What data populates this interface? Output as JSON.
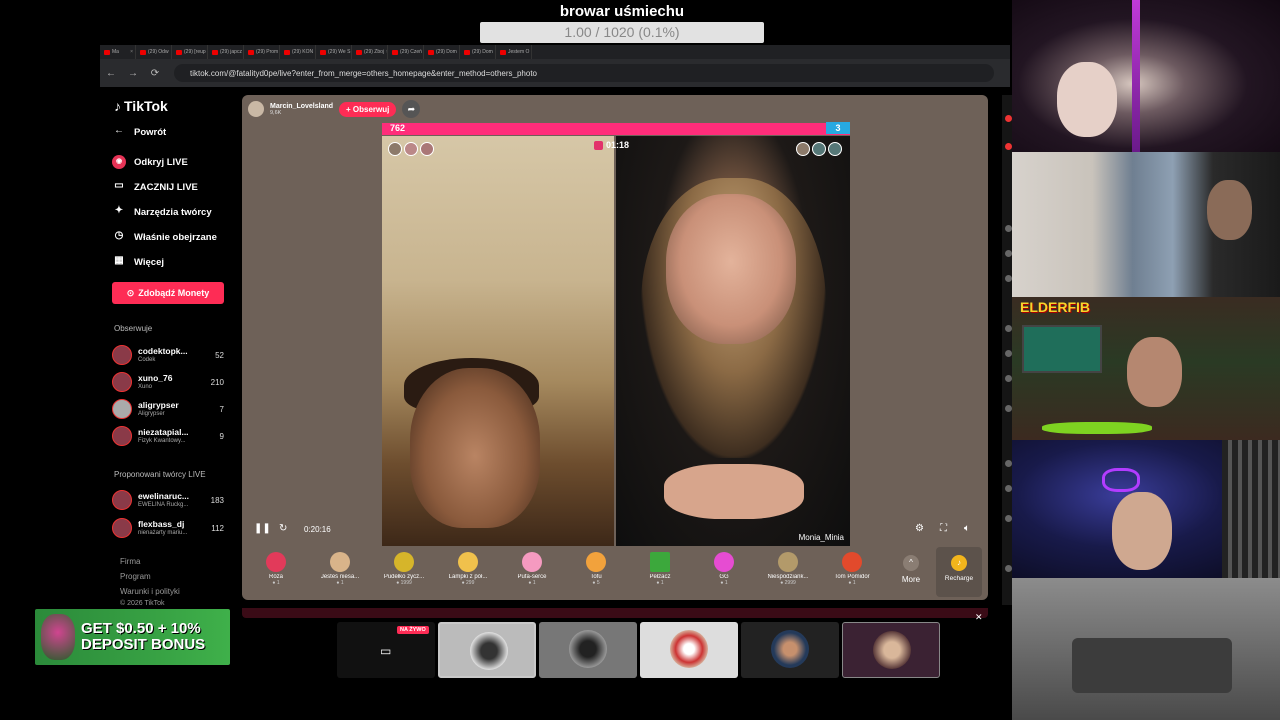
{
  "overlay": {
    "title": "browar uśmiechu",
    "goal_text": "1.00 / 1020 (0.1%)"
  },
  "browser": {
    "tabs": [
      "Ma",
      "(29) Odw",
      "(29) [reup",
      "(29) japcz",
      "(29) Prom",
      "(29) KON",
      "(29) We S",
      "(29) Zboj",
      "(29) Czeń",
      "(29) Dom",
      "(29) Dom",
      "Jestem O"
    ],
    "url": "tiktok.com/@fatalityd0pe/live?enter_from_merge=others_homepage&enter_method=others_photo"
  },
  "sidebar": {
    "logo": "TikTok",
    "nav": [
      {
        "label": "Powrót",
        "icon": "back-arrow-icon"
      },
      {
        "label": "Odkryj LIVE",
        "icon": "live-icon"
      },
      {
        "label": "ZACZNIJ LIVE",
        "icon": "camera-icon"
      },
      {
        "label": "Narzędzia twórcy",
        "icon": "lightbulb-icon"
      },
      {
        "label": "Właśnie obejrzane",
        "icon": "history-icon"
      },
      {
        "label": "Więcej",
        "icon": "more-icon"
      }
    ],
    "coins_button": "Zdobądź Monety",
    "followed_heading": "Obserwuje",
    "followed": [
      {
        "name": "codektopk...",
        "sub": "Codek",
        "count": "52"
      },
      {
        "name": "xuno_76",
        "sub": "Xuno",
        "count": "210"
      },
      {
        "name": "aligrypser",
        "sub": "Aligrypser",
        "count": "7"
      },
      {
        "name": "niezatapial...",
        "sub": "Fizyk Kwantowy...",
        "count": "9"
      }
    ],
    "suggested_heading": "Proponowani twórcy LIVE",
    "suggested": [
      {
        "name": "ewelinaruc...",
        "sub": "EWELINA Ruckg...",
        "count": "183"
      },
      {
        "name": "flexbass_dj",
        "sub": "nienażarty mariu...",
        "count": "112"
      }
    ],
    "footer": [
      "Firma",
      "Program",
      "Warunki i polityki",
      "© 2026 TikTok"
    ]
  },
  "player": {
    "host_name": "Marcin_Lovelsland",
    "host_views": "9,6K",
    "follow_label": "+ Obserwuj",
    "score_left": "762",
    "score_right": "3",
    "battle_timer": "01:18",
    "opponent_name": "Monia_Minia",
    "elapsed": "0:20:16",
    "gifts": [
      {
        "name": "Róża",
        "price": "1",
        "color": "#e23a5a"
      },
      {
        "name": "Jesteś niesa...",
        "price": "1",
        "color": "#d9b48a"
      },
      {
        "name": "Pudełko życz...",
        "price": "1999",
        "color": "#d6b52a"
      },
      {
        "name": "Lampki z pół...",
        "price": "299",
        "color": "#f0c14c"
      },
      {
        "name": "Pufa-serce",
        "price": "1",
        "color": "#f59ac0"
      },
      {
        "name": "Tofu",
        "price": "5",
        "color": "#f2a23c"
      },
      {
        "name": "Pełzacz",
        "price": "1",
        "color": "#3ca83c"
      },
      {
        "name": "GG",
        "price": "1",
        "color": "#e64cd2"
      },
      {
        "name": "Niespodziank...",
        "price": "2999",
        "color": "#b39a6a"
      },
      {
        "name": "Tom Pomidor",
        "price": "1",
        "color": "#e24a2c"
      }
    ],
    "more_label": "More",
    "recharge_label": "Recharge"
  },
  "streams": {
    "live_badge": "NA ŻYWO"
  },
  "promo": {
    "text": "GET $0.50 + 10% DEPOSIT BONUS"
  },
  "cams": {
    "elder_logo": "ELDERFIB"
  }
}
